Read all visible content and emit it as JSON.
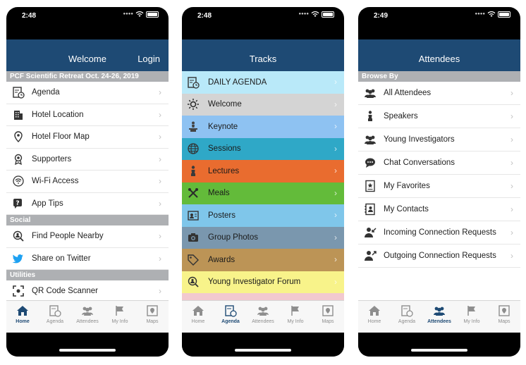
{
  "phones": [
    {
      "time": "2:48",
      "nav": {
        "title": "Welcome",
        "login": "Login"
      },
      "sections": [
        {
          "header": "PCF Scientific Retreat Oct. 24-26, 2019",
          "items": [
            {
              "label": "Agenda",
              "icon": "agenda-icon"
            },
            {
              "label": "Hotel Location",
              "icon": "building-icon"
            },
            {
              "label": "Hotel Floor Map",
              "icon": "map-pin-icon"
            },
            {
              "label": "Supporters",
              "icon": "ribbon-icon"
            },
            {
              "label": "Wi-Fi Access",
              "icon": "wifi-icon"
            },
            {
              "label": "App Tips",
              "icon": "tips-icon"
            }
          ]
        },
        {
          "header": "Social",
          "items": [
            {
              "label": "Find People Nearby",
              "icon": "search-person-icon"
            },
            {
              "label": "Share on Twitter",
              "icon": "twitter-icon"
            }
          ]
        },
        {
          "header": "Utilities",
          "items": [
            {
              "label": "QR Code Scanner",
              "icon": "qr-scanner-icon"
            }
          ]
        }
      ],
      "tabs": [
        {
          "label": "Home",
          "active": true
        },
        {
          "label": "Agenda",
          "active": false
        },
        {
          "label": "Attendees",
          "active": false
        },
        {
          "label": "My Info",
          "active": false
        },
        {
          "label": "Maps",
          "active": false
        }
      ]
    },
    {
      "time": "2:48",
      "nav": {
        "title": "Tracks"
      },
      "tracks": [
        {
          "label": "DAILY AGENDA",
          "color": "#b9e9f9",
          "icon": "agenda-icon"
        },
        {
          "label": "Welcome",
          "color": "#d4d4d4",
          "icon": "sun-icon"
        },
        {
          "label": "Keynote",
          "color": "#8ec2f2",
          "icon": "keynote-icon"
        },
        {
          "label": "Sessions",
          "color": "#2fa8c7",
          "icon": "globe-icon"
        },
        {
          "label": "Lectures",
          "color": "#e96c2f",
          "icon": "lecture-icon"
        },
        {
          "label": "Meals",
          "color": "#63bb3a",
          "icon": "utensils-icon"
        },
        {
          "label": "Posters",
          "color": "#7fc6ea",
          "icon": "poster-icon"
        },
        {
          "label": "Group Photos",
          "color": "#7a97ae",
          "icon": "camera-icon"
        },
        {
          "label": "Awards",
          "color": "#bc9456",
          "icon": "tag-icon"
        },
        {
          "label": "Young Investigator Forum",
          "color": "#f8f38a",
          "icon": "search-person-icon"
        },
        {
          "label": "",
          "color": "#f2c9cf",
          "icon": "partial-icon"
        }
      ],
      "tabs": [
        {
          "label": "Home",
          "active": false
        },
        {
          "label": "Agenda",
          "active": true
        },
        {
          "label": "Attendees",
          "active": false
        },
        {
          "label": "My Info",
          "active": false
        },
        {
          "label": "Maps",
          "active": false
        }
      ]
    },
    {
      "time": "2:49",
      "nav": {
        "title": "Attendees"
      },
      "header": "Browse By",
      "items": [
        {
          "label": "All Attendees",
          "icon": "group-icon"
        },
        {
          "label": "Speakers",
          "icon": "speaker-icon"
        },
        {
          "label": "Young Investigators",
          "icon": "group-icon"
        },
        {
          "label": "Chat Conversations",
          "icon": "chat-icon"
        },
        {
          "label": "My Favorites",
          "icon": "favorite-icon"
        },
        {
          "label": "My Contacts",
          "icon": "contacts-icon"
        },
        {
          "label": "Incoming Connection Requests",
          "icon": "incoming-request-icon"
        },
        {
          "label": "Outgoing Connection Requests",
          "icon": "outgoing-request-icon"
        }
      ],
      "tabs": [
        {
          "label": "Home",
          "active": false
        },
        {
          "label": "Agenda",
          "active": false
        },
        {
          "label": "Attendees",
          "active": true
        },
        {
          "label": "My Info",
          "active": false
        },
        {
          "label": "Maps",
          "active": false
        }
      ]
    }
  ]
}
